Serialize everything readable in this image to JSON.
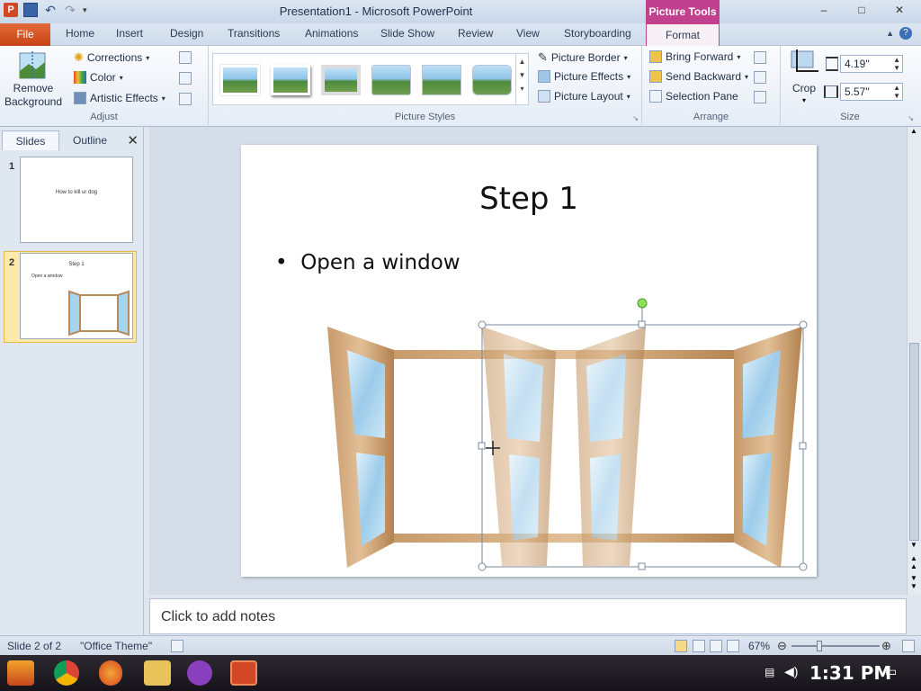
{
  "titlebar": {
    "title": "Presentation1 - Microsoft PowerPoint",
    "contextual": "Picture Tools",
    "window_buttons": [
      "–",
      "□",
      "✕"
    ]
  },
  "tabs": {
    "file": "File",
    "items": [
      "Home",
      "Insert",
      "Design",
      "Transitions",
      "Animations",
      "Slide Show",
      "Review",
      "View",
      "Storyboarding"
    ],
    "format": "Format"
  },
  "ribbon": {
    "adjust": {
      "label": "Adjust",
      "remove_bg": "Remove Background",
      "corrections": "Corrections",
      "color": "Color",
      "artistic": "Artistic Effects"
    },
    "styles": {
      "label": "Picture Styles",
      "border": "Picture Border",
      "effects": "Picture Effects",
      "layout": "Picture Layout"
    },
    "arrange": {
      "label": "Arrange",
      "bring_forward": "Bring Forward",
      "send_backward": "Send Backward",
      "selection_pane": "Selection Pane"
    },
    "size": {
      "label": "Size",
      "crop": "Crop",
      "height": "4.19\"",
      "width": "5.57\""
    }
  },
  "pane": {
    "tab_slides": "Slides",
    "tab_outline": "Outline",
    "close": "✕",
    "slides": [
      {
        "num": "1",
        "title": "How to kill ur dog"
      },
      {
        "num": "2",
        "title": "Step 1",
        "bullet": "Open a window"
      }
    ]
  },
  "slide": {
    "title": "Step 1",
    "bullet": "Open a window"
  },
  "notes": {
    "placeholder": "Click to add notes"
  },
  "status": {
    "slide_count": "Slide 2 of 2",
    "theme": "\"Office Theme\"",
    "zoom": "67%"
  },
  "taskbar": {
    "clock": "1:31 PM"
  }
}
